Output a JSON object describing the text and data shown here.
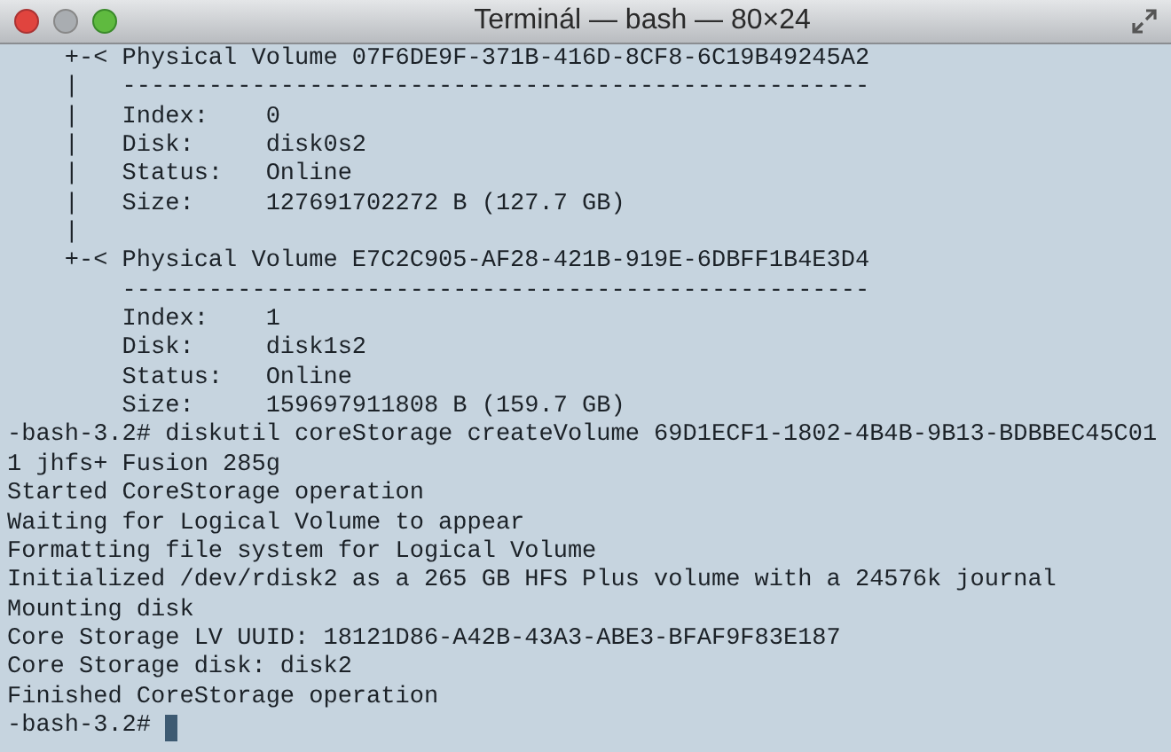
{
  "window": {
    "title": "Terminál — bash — 80×24"
  },
  "lines": [
    "    +-< Physical Volume 07F6DE9F-371B-416D-8CF8-6C19B49245A2",
    "    |   ----------------------------------------------------",
    "    |   Index:    0",
    "    |   Disk:     disk0s2",
    "    |   Status:   Online",
    "    |   Size:     127691702272 B (127.7 GB)",
    "    |",
    "    +-< Physical Volume E7C2C905-AF28-421B-919E-6DBFF1B4E3D4",
    "        ----------------------------------------------------",
    "        Index:    1",
    "        Disk:     disk1s2",
    "        Status:   Online",
    "        Size:     159697911808 B (159.7 GB)",
    "-bash-3.2# diskutil coreStorage createVolume 69D1ECF1-1802-4B4B-9B13-BDBBEC45C01",
    "1 jhfs+ Fusion 285g",
    "Started CoreStorage operation",
    "Waiting for Logical Volume to appear",
    "Formatting file system for Logical Volume",
    "Initialized /dev/rdisk2 as a 265 GB HFS Plus volume with a 24576k journal",
    "Mounting disk",
    "Core Storage LV UUID: 18121D86-A42B-43A3-ABE3-BFAF9F83E187",
    "Core Storage disk: disk2",
    "Finished CoreStorage operation"
  ],
  "prompt": {
    "text": "-bash-3.2#",
    "cursor": true
  }
}
